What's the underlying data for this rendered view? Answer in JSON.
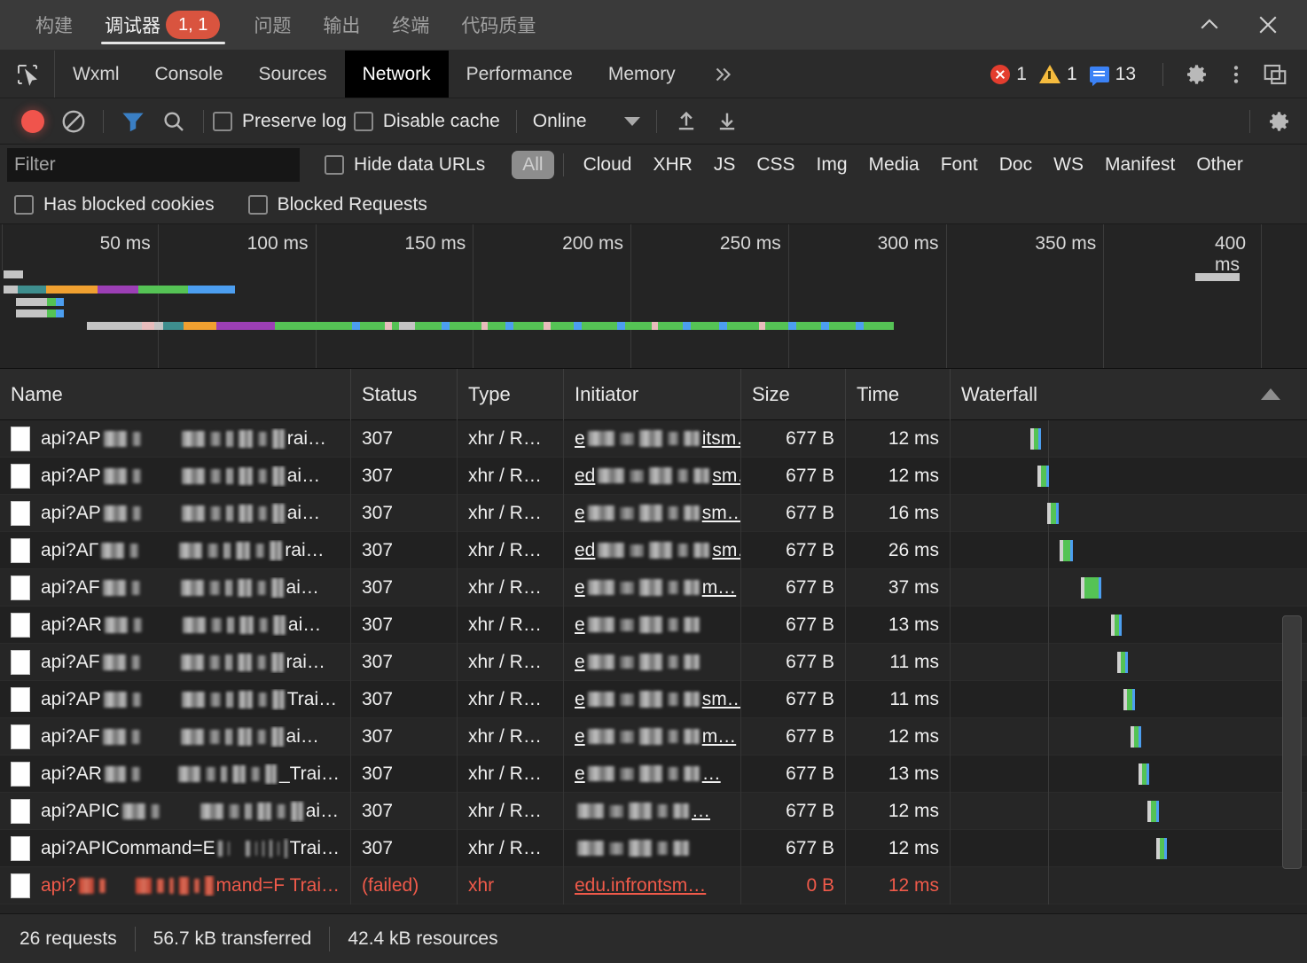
{
  "ide": {
    "tabs": [
      {
        "label": "构建",
        "active": false,
        "badge": null
      },
      {
        "label": "调试器",
        "active": true,
        "badge": "1, 1"
      },
      {
        "label": "问题",
        "active": false,
        "badge": null
      },
      {
        "label": "输出",
        "active": false,
        "badge": null
      },
      {
        "label": "终端",
        "active": false,
        "badge": null
      },
      {
        "label": "代码质量",
        "active": false,
        "badge": null
      }
    ],
    "collapse_icon": "chevron-up-icon",
    "close_icon": "close-icon"
  },
  "devtools": {
    "inspect_icon": "inspect-element-icon",
    "tabs": [
      {
        "label": "Wxml",
        "active": false
      },
      {
        "label": "Console",
        "active": false
      },
      {
        "label": "Sources",
        "active": false
      },
      {
        "label": "Network",
        "active": true
      },
      {
        "label": "Performance",
        "active": false
      },
      {
        "label": "Memory",
        "active": false
      }
    ],
    "more_tabs_icon": "chevrons-right-icon",
    "counters": {
      "errors": "1",
      "warnings": "1",
      "info": "13"
    },
    "settings_icon": "gear-icon",
    "kebab_icon": "more-vertical-icon",
    "dock_icon": "dock-panel-icon"
  },
  "network_toolbar": {
    "record_icon": "record-circle-icon",
    "clear_icon": "clear-no-entry-icon",
    "filter_icon": "funnel-filter-icon",
    "search_icon": "search-icon",
    "preserve_log_label": "Preserve log",
    "preserve_log_checked": false,
    "disable_cache_label": "Disable cache",
    "disable_cache_checked": false,
    "throttle_value": "Online",
    "throttle_caret_icon": "chevron-down-icon",
    "import_icon": "upload-arrow-icon",
    "export_icon": "download-arrow-icon",
    "settings_icon": "gear-icon"
  },
  "filter_bar": {
    "filter_placeholder": "Filter",
    "filter_value": "",
    "hide_data_urls_label": "Hide data URLs",
    "hide_data_urls_checked": false,
    "types": [
      {
        "label": "All",
        "active": true
      },
      {
        "label": "Cloud",
        "active": false
      },
      {
        "label": "XHR",
        "active": false
      },
      {
        "label": "JS",
        "active": false
      },
      {
        "label": "CSS",
        "active": false
      },
      {
        "label": "Img",
        "active": false
      },
      {
        "label": "Media",
        "active": false
      },
      {
        "label": "Font",
        "active": false
      },
      {
        "label": "Doc",
        "active": false
      },
      {
        "label": "WS",
        "active": false
      },
      {
        "label": "Manifest",
        "active": false
      },
      {
        "label": "Other",
        "active": false
      }
    ]
  },
  "blocked_bar": {
    "has_blocked_cookies_label": "Has blocked cookies",
    "has_blocked_cookies_checked": false,
    "blocked_requests_label": "Blocked Requests",
    "blocked_requests_checked": false
  },
  "overview": {
    "ticks": [
      "50 ms",
      "100 ms",
      "150 ms",
      "200 ms",
      "250 ms",
      "300 ms",
      "350 ms",
      "400 ms"
    ],
    "colors": {
      "queueing": "#c4c4c4",
      "stalled": "#3e8e8e",
      "dns": "#f0a030",
      "connect": "#9c3fb5",
      "ttfb": "#55c355",
      "download": "#4c9ef0",
      "pink": "#e8bcbc"
    }
  },
  "table": {
    "columns": [
      "Name",
      "Status",
      "Type",
      "Initiator",
      "Size",
      "Time",
      "Waterfall"
    ],
    "sort_icon": "sort-ascending-icon",
    "rows": [
      {
        "name_prefix": "api?AP",
        "name_suffix": "rai…",
        "status": "307",
        "type": "xhr / R…",
        "initiator_prefix": "e",
        "initiator_suffix": "itsm…",
        "size": "677 B",
        "time": "12 ms",
        "failed": false,
        "wf_start": 56.5,
        "wf_wait": 0.6,
        "wf_recv": 1.8,
        "wf_blue": 0.5
      },
      {
        "name_prefix": "api?AP",
        "name_suffix": "ai…",
        "status": "307",
        "type": "xhr / R…",
        "initiator_prefix": "ed",
        "initiator_suffix": "sm…",
        "size": "677 B",
        "time": "12 ms",
        "failed": false,
        "wf_start": 59.4,
        "wf_wait": 0.6,
        "wf_recv": 1.9,
        "wf_blue": 0.3
      },
      {
        "name_prefix": "api?AP",
        "name_suffix": "ai…",
        "status": "307",
        "type": "xhr / R…",
        "initiator_prefix": "e",
        "initiator_suffix": "sm…",
        "size": "677 B",
        "time": "16 ms",
        "failed": false,
        "wf_start": 63.0,
        "wf_wait": 0.9,
        "wf_recv": 2.1,
        "wf_blue": 0.6
      },
      {
        "name_prefix": "api?AΓ",
        "name_suffix": "rai…",
        "status": "307",
        "type": "xhr / R…",
        "initiator_prefix": "ed",
        "initiator_suffix": "sm…",
        "size": "677 B",
        "time": "26 ms",
        "failed": false,
        "wf_start": 67.8,
        "wf_wait": 1.0,
        "wf_recv": 2.4,
        "wf_blue": 0.6
      },
      {
        "name_prefix": "api?AF",
        "name_suffix": "ai…",
        "status": "307",
        "type": "xhr / R…",
        "initiator_prefix": "e",
        "initiator_suffix": "m…",
        "size": "677 B",
        "time": "37 ms",
        "failed": false,
        "wf_start": 75.5,
        "wf_wait": 0.9,
        "wf_recv": 5.6,
        "wf_blue": 0.6
      },
      {
        "name_prefix": "api?AR",
        "name_suffix": "ai…",
        "status": "307",
        "type": "xhr / R…",
        "initiator_prefix": "e",
        "initiator_suffix": "",
        "size": "677 B",
        "time": "13 ms",
        "failed": false,
        "wf_start": 87.0,
        "wf_wait": 0.8,
        "wf_recv": 1.8,
        "wf_blue": 0.7
      },
      {
        "name_prefix": "api?AF",
        "name_suffix": "rai…",
        "status": "307",
        "type": "xhr / R…",
        "initiator_prefix": "e",
        "initiator_suffix": "",
        "size": "677 B",
        "time": "11 ms",
        "failed": false,
        "wf_start": 89.3,
        "wf_wait": 0.6,
        "wf_recv": 1.2,
        "wf_blue": 0.8
      },
      {
        "name_prefix": "api?AP",
        "name_suffix": "Trai…",
        "status": "307",
        "type": "xhr / R…",
        "initiator_prefix": "e",
        "initiator_suffix": "sm…",
        "size": "677 B",
        "time": "11 ms",
        "failed": false,
        "wf_start": 91.8,
        "wf_wait": 0.6,
        "wf_recv": 1.8,
        "wf_blue": 0.3
      },
      {
        "name_prefix": "api?AF",
        "name_suffix": "ai…",
        "status": "307",
        "type": "xhr / R…",
        "initiator_prefix": "e",
        "initiator_suffix": "m…",
        "size": "677 B",
        "time": "12 ms",
        "failed": false,
        "wf_start": 94.4,
        "wf_wait": 0.7,
        "wf_recv": 1.6,
        "wf_blue": 0.7
      },
      {
        "name_prefix": "api?AR",
        "name_suffix": "_Trai…",
        "status": "307",
        "type": "xhr / R…",
        "initiator_prefix": "e",
        "initiator_suffix": "…",
        "size": "677 B",
        "time": "13 ms",
        "failed": false,
        "wf_start": 97.3,
        "wf_wait": 0.6,
        "wf_recv": 1.7,
        "wf_blue": 0.8
      },
      {
        "name_prefix": "api?APIC",
        "name_suffix": "ai…",
        "status": "307",
        "type": "xhr / R…",
        "initiator_prefix": "",
        "initiator_suffix": "…",
        "size": "677 B",
        "time": "12 ms",
        "failed": false,
        "wf_start": 100.8,
        "wf_wait": 0.6,
        "wf_recv": 1.8,
        "wf_blue": 0.3
      },
      {
        "name_prefix": "api?APICommand=E",
        "name_suffix": "Trai…",
        "status": "307",
        "type": "xhr / R…",
        "initiator_prefix": "",
        "initiator_suffix": "",
        "size": "677 B",
        "time": "12 ms",
        "failed": false,
        "wf_start": 104.0,
        "wf_wait": 0.6,
        "wf_recv": 1.5,
        "wf_blue": 0.7
      },
      {
        "name_prefix": "api?",
        "name_suffix": "mand=F",
        "name_tail": "Trai…",
        "status": "(failed)",
        "type": "xhr",
        "initiator_full": "edu.infrontsm…",
        "size": "0 B",
        "time": "12 ms",
        "failed": true,
        "wf_start": 0,
        "wf_wait": 0,
        "wf_recv": 0,
        "wf_blue": 0
      }
    ]
  },
  "statusbar": {
    "requests": "26 requests",
    "transferred": "56.7 kB transferred",
    "resources": "42.4 kB resources"
  }
}
